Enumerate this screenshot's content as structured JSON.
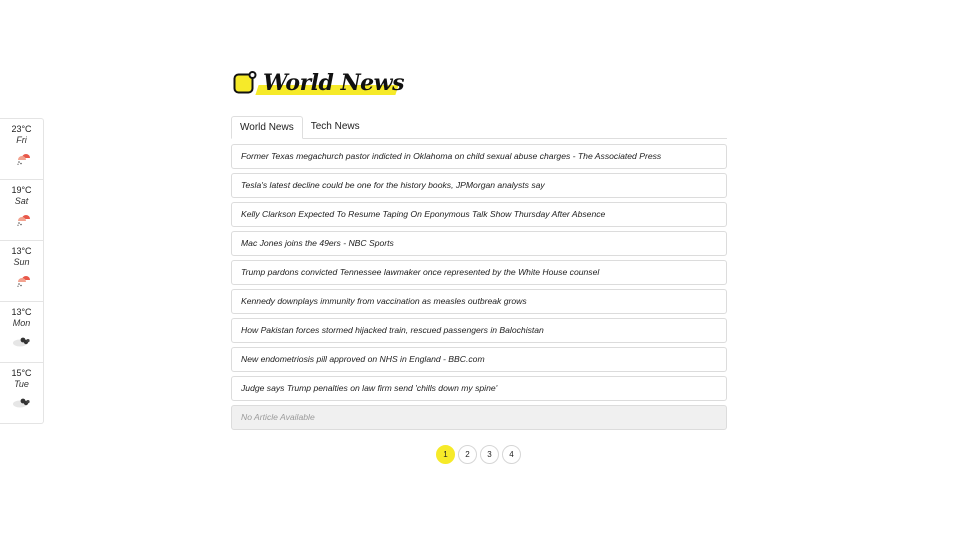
{
  "header": {
    "title": "World News",
    "accent_color": "#f6ea29"
  },
  "weather": [
    {
      "temp": "23°C",
      "day": "Fri",
      "icon": "sun-rain-icon"
    },
    {
      "temp": "19°C",
      "day": "Sat",
      "icon": "sun-rain-icon"
    },
    {
      "temp": "13°C",
      "day": "Sun",
      "icon": "sun-rain-icon"
    },
    {
      "temp": "13°C",
      "day": "Mon",
      "icon": "clouds-icon"
    },
    {
      "temp": "15°C",
      "day": "Tue",
      "icon": "clouds-icon"
    }
  ],
  "tabs": [
    {
      "label": "World News",
      "active": true
    },
    {
      "label": "Tech News",
      "active": false
    }
  ],
  "articles": [
    "Former Texas megachurch pastor indicted in Oklahoma on child sexual abuse charges - The Associated Press",
    "Tesla's latest decline could be one for the history books, JPMorgan analysts say",
    "Kelly Clarkson Expected To Resume Taping On Eponymous Talk Show Thursday After Absence",
    "Mac Jones joins the 49ers - NBC Sports",
    "Trump pardons convicted Tennessee lawmaker once represented by the White House counsel",
    "Kennedy downplays immunity from vaccination as measles outbreak grows",
    "How Pakistan forces stormed hijacked train, rescued passengers in Balochistan",
    "New endometriosis pill approved on NHS in England - BBC.com",
    "Judge says Trump penalties on law firm send 'chills down my spine'"
  ],
  "empty_article": "No Article Available",
  "pagination": {
    "pages": [
      "1",
      "2",
      "3",
      "4"
    ],
    "current": "1"
  }
}
